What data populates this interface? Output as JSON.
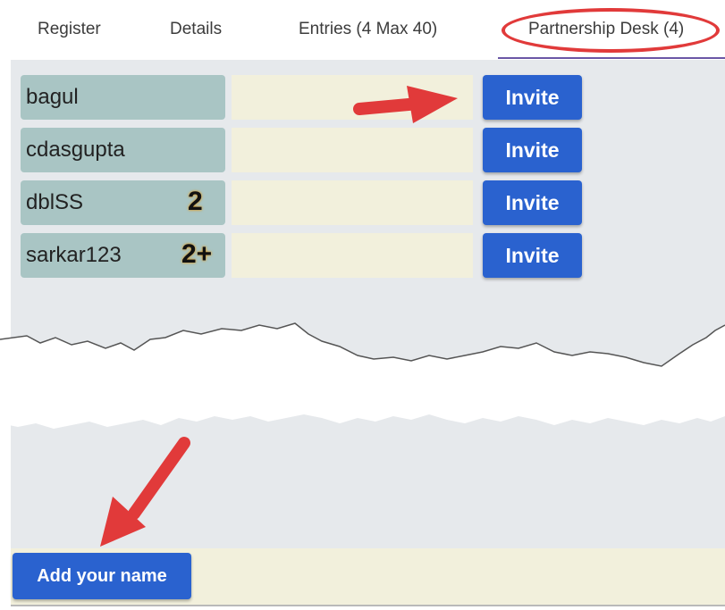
{
  "tabs": [
    {
      "label": "Register"
    },
    {
      "label": "Details"
    },
    {
      "label": "Entries (4 Max 40)"
    },
    {
      "label": "Partnership Desk (4)"
    }
  ],
  "active_tab": "Partnership Desk (4)",
  "players": [
    {
      "name": "bagul",
      "badge": "",
      "invite_label": "Invite"
    },
    {
      "name": "cdasgupta",
      "badge": "",
      "invite_label": "Invite"
    },
    {
      "name": "dblSS",
      "badge": "2",
      "invite_label": "Invite"
    },
    {
      "name": "sarkar123",
      "badge": "2+",
      "invite_label": "Invite"
    }
  ],
  "add_button": {
    "label": "Add your name"
  },
  "colors": {
    "button": "#2a62cf",
    "name_box": "#a9c5c4",
    "input_box": "#f2f0dc",
    "panel": "#e6e9ec",
    "annotation": "#e13a3a"
  }
}
